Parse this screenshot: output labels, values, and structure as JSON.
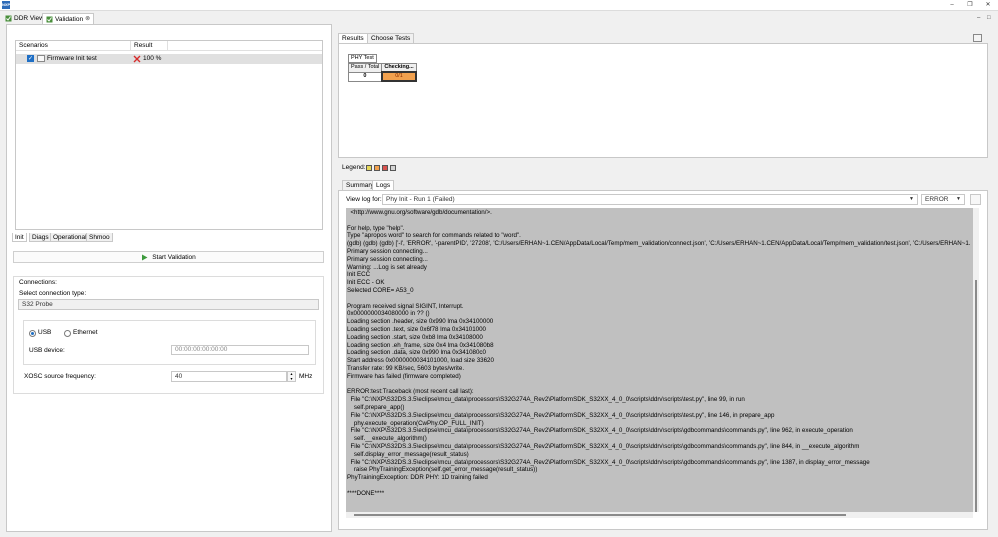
{
  "window": {
    "app_icon_text": "NXP"
  },
  "editor_tabs": [
    {
      "label": "DDR View"
    },
    {
      "label": "Validation",
      "close": "⊗"
    }
  ],
  "scenarios": {
    "columns": [
      "Scenarios",
      "Result"
    ],
    "rows": [
      {
        "name": "Firmware Init test",
        "result": "100 %",
        "checked": true,
        "status_icon": "fail-x-icon"
      }
    ]
  },
  "bottom_tabs": [
    "Init",
    "Diags",
    "Operational",
    "Shmoo"
  ],
  "start_button": {
    "label": "Start Validation"
  },
  "connections": {
    "title": "Connections:",
    "select_label": "Select connection type:",
    "type_value": "S32 Probe",
    "usb_label": "USB",
    "ethernet_label": "Ethernet",
    "selected": "USB",
    "usb_device_label": "USB device:",
    "usb_device_placeholder": "00:00:00:00:00:00",
    "xosc_label": "XOSC source frequency:",
    "xosc_value": "40",
    "xosc_unit": "MHz"
  },
  "results": {
    "tabs": [
      "Results",
      "Choose Tests"
    ],
    "phy_test": {
      "title": "PHY Test",
      "col_pass_total": "Pass / Total",
      "col_checking": "Checking...",
      "pass_total_value": "0",
      "checking_value": "0/1"
    },
    "legend_label": "Legend:",
    "legend_colors": [
      "#e6d85a",
      "#f2a14e",
      "#d9534f",
      "#d4d4d4"
    ]
  },
  "logs": {
    "tabs": [
      "Summary",
      "Logs"
    ],
    "view_label": "View log for:",
    "view_value": "Phy Init - Run 1 (Failed)",
    "level_value": "ERROR",
    "lines": [
      "  <http://www.gnu.org/software/gdb/documentation/>.",
      "",
      "For help, type \"help\".",
      "Type \"apropos word\" to search for commands related to \"word\".",
      "(gdb) (gdb) (gdb) ['-l', 'ERROR', '-parentPID', '27208', 'C:/Users/ERHAN~1.CEN/AppData/Local/Temp/mem_validation/connect.json', 'C:/Users/ERHAN~1.CEN/AppData/Local/Temp/mem_validation/test.json', 'C:/Users/ERHAN~1.",
      "Primary session connecting...",
      "Primary session connecting...",
      "Warning: ...Log is set already",
      "Init ECC",
      "Init ECC - OK",
      "Selected CORE= A53_0",
      "",
      "Program received signal SIGINT, Interrupt.",
      "0x0000000034080000 in ?? ()",
      "Loading section .header, size 0x990 lma 0x34100000",
      "Loading section .text, size 0x6f78 lma 0x34101000",
      "Loading section .start, size 0xb8 lma 0x34108000",
      "Loading section .eh_frame, size 0x4 lma 0x341080b8",
      "Loading section .data, size 0x990 lma 0x341080c0",
      "Start address 0x0000000034101000, load size 33620",
      "Transfer rate: 99 KB/sec, 5603 bytes/write.",
      "Firmware has failed (firmware completed)",
      "",
      "ERROR:test:Traceback (most recent call last):",
      "  File \"C:\\NXP\\S32DS.3.5\\eclipse\\mcu_data\\processors\\S32G274A_Rev2\\PlatformSDK_S32XX_4_0_0\\scripts\\ddrv\\scripts\\test.py\", line 99, in run",
      "    self.prepare_app()",
      "  File \"C:\\NXP\\S32DS.3.5\\eclipse\\mcu_data\\processors\\S32G274A_Rev2\\PlatformSDK_S32XX_4_0_0\\scripts\\ddrv\\scripts\\test.py\", line 146, in prepare_app",
      "    phy.execute_operation(CwPhy.OP_FULL_INIT)",
      "  File \"C:\\NXP\\S32DS.3.5\\eclipse\\mcu_data\\processors\\S32G274A_Rev2\\PlatformSDK_S32XX_4_0_0\\scripts\\ddrv\\scripts\\gdbcommands\\commands.py\", line 962, in execute_operation",
      "    self.__execute_algorithm()",
      "  File \"C:\\NXP\\S32DS.3.5\\eclipse\\mcu_data\\processors\\S32G274A_Rev2\\PlatformSDK_S32XX_4_0_0\\scripts\\ddrv\\scripts\\gdbcommands\\commands.py\", line 844, in __execute_algorithm",
      "    self.display_error_message(result_status)",
      "  File \"C:\\NXP\\S32DS.3.5\\eclipse\\mcu_data\\processors\\S32G274A_Rev2\\PlatformSDK_S32XX_4_0_0\\scripts\\ddrv\\scripts\\gdbcommands\\commands.py\", line 1387, in display_error_message",
      "    raise PhyTrainingException(self.get_error_message(result_status))",
      "PhyTrainingException: DDR PHY: 1D training failed",
      "",
      "****DONE****"
    ]
  }
}
